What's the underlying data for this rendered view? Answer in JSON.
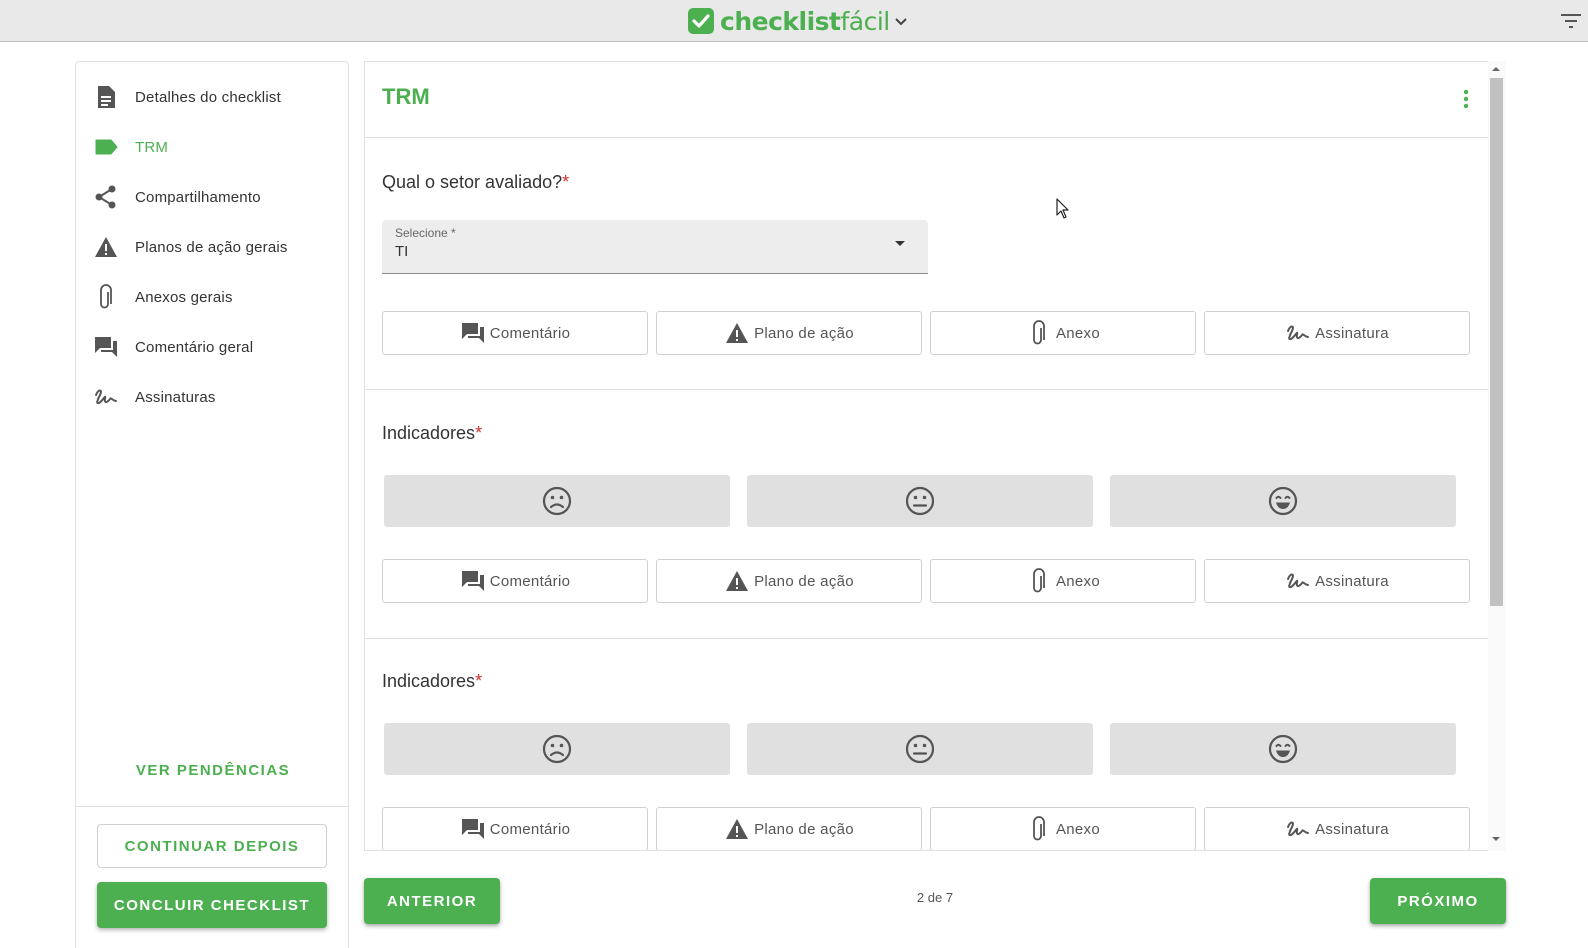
{
  "brand": {
    "bold": "checklist",
    "light": "fácil"
  },
  "colors": {
    "accent": "#4caf50",
    "required": "#d32f2f"
  },
  "sidebar": {
    "items": [
      {
        "label": "Detalhes do checklist",
        "icon": "document-icon"
      },
      {
        "label": "TRM",
        "icon": "label-tag-icon",
        "active": true
      },
      {
        "label": "Compartilhamento",
        "icon": "share-icon"
      },
      {
        "label": "Planos de ação gerais",
        "icon": "warning-icon"
      },
      {
        "label": "Anexos gerais",
        "icon": "paperclip-icon"
      },
      {
        "label": "Comentário geral",
        "icon": "comment-icon"
      },
      {
        "label": "Assinaturas",
        "icon": "signature-icon"
      }
    ],
    "pending_label": "VER PENDÊNCIAS",
    "continue_label": "CONTINUAR DEPOIS",
    "finish_label": "CONCLUIR CHECKLIST"
  },
  "card": {
    "title": "TRM",
    "questions": [
      {
        "label": "Qual o setor avaliado?",
        "required": "*",
        "select_label": "Selecione *",
        "select_value": "TI"
      },
      {
        "label": "Indicadores",
        "required": "*"
      },
      {
        "label": "Indicadores",
        "required": "*"
      }
    ],
    "actions": {
      "comment": "Comentário",
      "action_plan": "Plano de ação",
      "attachment": "Anexo",
      "signature": "Assinatura"
    },
    "faces": [
      "sad-face-icon",
      "neutral-face-icon",
      "happy-face-icon"
    ]
  },
  "nav": {
    "prev_label": "ANTERIOR",
    "next_label": "PRÓXIMO",
    "page_indicator": "2 de 7"
  }
}
